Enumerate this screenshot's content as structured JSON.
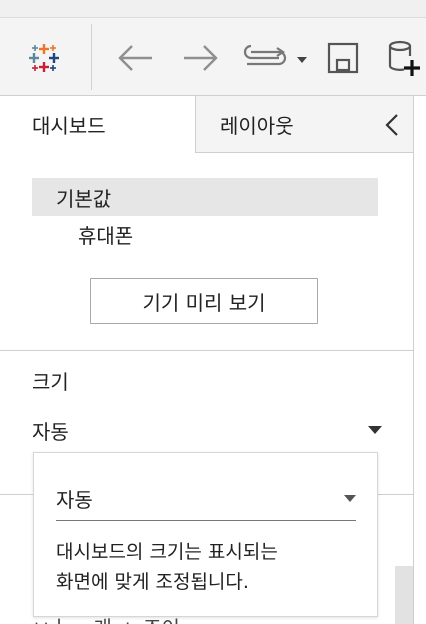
{
  "tabs": {
    "dashboard": "대시보드",
    "layout": "레이아웃"
  },
  "devices": {
    "default": "기본값",
    "phone": "휴대폰"
  },
  "preview_button": "기기 미리 보기",
  "size": {
    "label": "크기",
    "value": "자동"
  },
  "dropdown": {
    "selected": "자동",
    "description_line1": "대시보드의 크기는 표시되는",
    "description_line2": "화면에 맞게 조정됩니다."
  },
  "peek_text": "ㅂㅏ ㅡ개 ㅅ 조이",
  "icons": {
    "logo": "tableau-logo-icon",
    "undo": "back-arrow-icon",
    "redo": "forward-arrow-icon",
    "replay": "replay-icon",
    "save": "save-icon",
    "new_datasource": "add-datasource-icon",
    "collapse": "chevron-left-icon"
  },
  "colors": {
    "logo_orange": "#e8762b",
    "logo_blue": "#5b879b",
    "logo_red": "#c72037",
    "logo_navy": "#1f457e",
    "logo_teal": "#59879b"
  }
}
